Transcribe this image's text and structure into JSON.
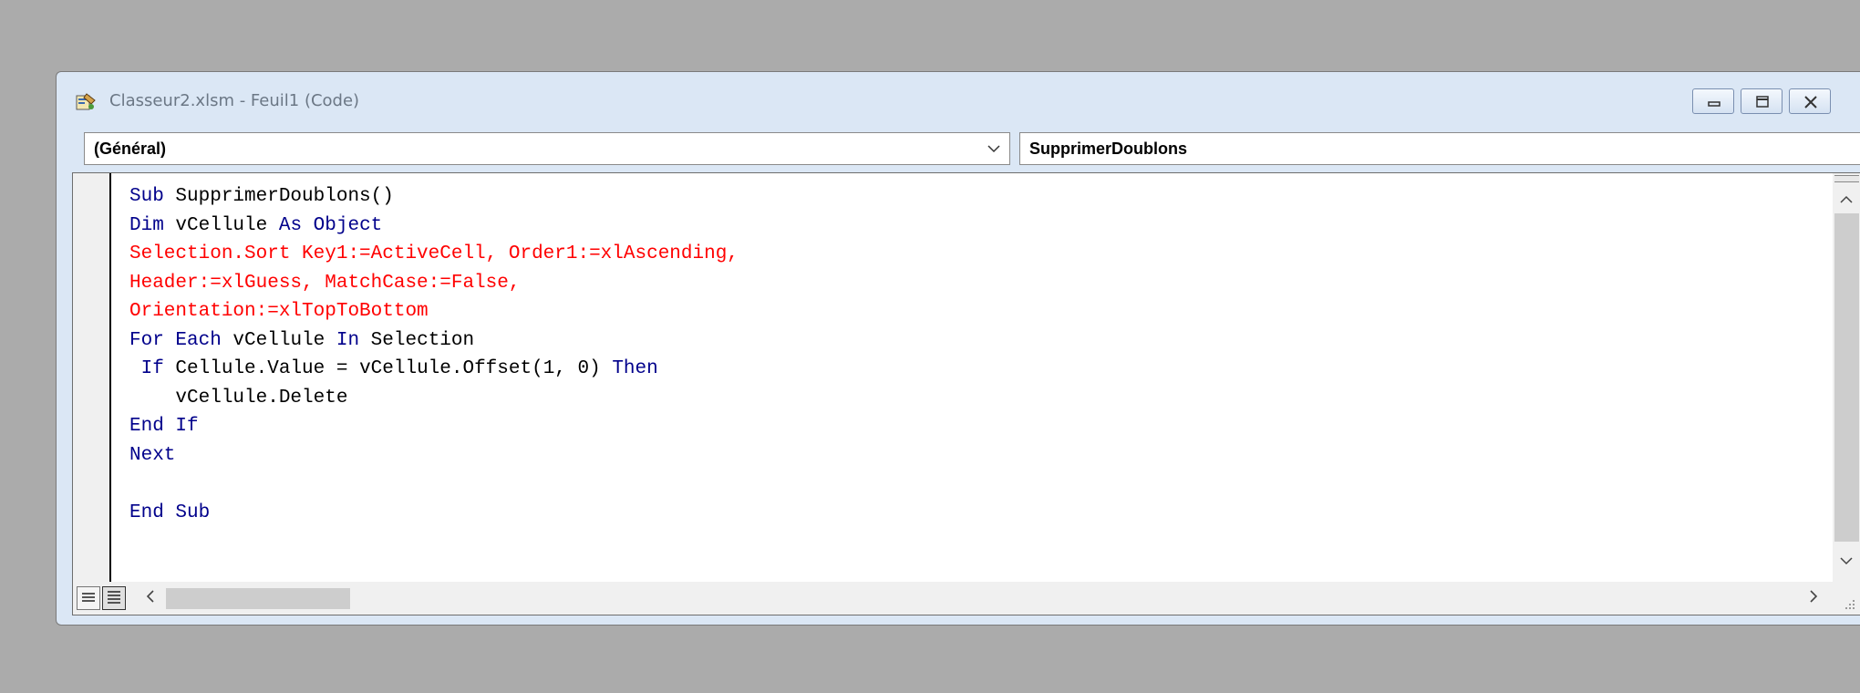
{
  "window": {
    "title": "Classeur2.xlsm - Feuil1 (Code)",
    "app_icon": "vba-code-icon",
    "buttons": [
      "minimize",
      "restore",
      "close"
    ]
  },
  "object_dropdown": {
    "selected": "(Général)"
  },
  "procedure_dropdown": {
    "selected": "SupprimerDoublons"
  },
  "colors": {
    "keyword": "#00008b",
    "identifier": "#000000",
    "syntax_error": "#ff0000"
  },
  "code": {
    "l1_kw1": "Sub",
    "l1_rest": " SupprimerDoublons()",
    "l2_kw1": "Dim",
    "l2_mid": " vCellule ",
    "l2_kw2": "As",
    "l2_sp": " ",
    "l2_kw3": "Object",
    "l3": "Selection.Sort Key1:=ActiveCell, Order1:=xlAscending,",
    "l4": "Header:=xlGuess, MatchCase:=False,",
    "l5": "Orientation:=xlTopToBottom",
    "l6_kw1": "For Each",
    "l6_mid": " vCellule ",
    "l6_kw2": "In",
    "l6_rest": " Selection",
    "l7_pre": " ",
    "l7_kw1": "If",
    "l7_mid": " Cellule.Value = vCellule.Offset(1, 0) ",
    "l7_kw2": "Then",
    "l8": "    vCellule.Delete",
    "l9": "End If",
    "l10": "Next",
    "l11": "",
    "l12": "End Sub"
  },
  "view_buttons": {
    "procedure_view": "procedure-view-icon",
    "full_module_view": "full-module-view-icon"
  }
}
